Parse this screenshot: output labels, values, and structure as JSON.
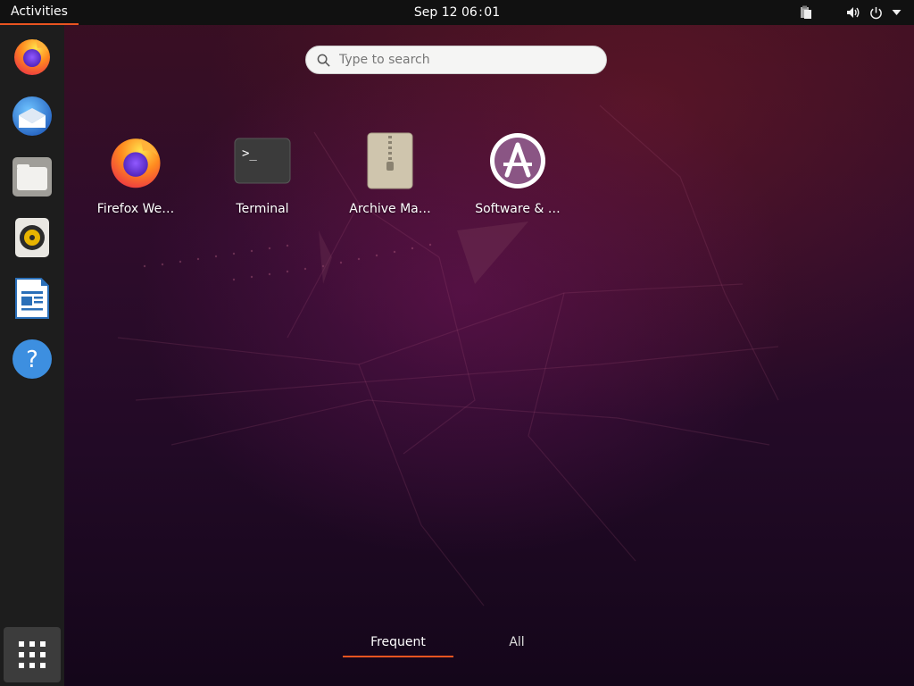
{
  "topbar": {
    "activities_label": "Activities",
    "clock": "Sep 12  06 : 01",
    "tray_icons": [
      "clipboard-icon",
      "volume-icon",
      "power-icon",
      "menu-arrow-icon"
    ]
  },
  "dock": {
    "items": [
      {
        "name": "firefox",
        "icon": "firefox-icon"
      },
      {
        "name": "thunderbird",
        "icon": "thunderbird-icon"
      },
      {
        "name": "files",
        "icon": "files-icon"
      },
      {
        "name": "rhythmbox",
        "icon": "rhythmbox-icon"
      },
      {
        "name": "libreoffice-writer",
        "icon": "writer-icon"
      },
      {
        "name": "help",
        "icon": "help-icon"
      }
    ],
    "show_apps_icon": "show-applications-icon"
  },
  "search": {
    "placeholder": "Type to search"
  },
  "apps": [
    {
      "label": "Firefox We…",
      "icon": "firefox-icon"
    },
    {
      "label": "Terminal",
      "icon": "terminal-icon"
    },
    {
      "label": "Archive Ma…",
      "icon": "archive-manager-icon"
    },
    {
      "label": "Software & …",
      "icon": "software-updates-icon"
    }
  ],
  "view_switch": {
    "frequent_label": "Frequent",
    "all_label": "All",
    "selected": "Frequent"
  },
  "colors": {
    "accent": "#e95420",
    "topbar": "#111111",
    "dock": "#1d1d1d"
  }
}
